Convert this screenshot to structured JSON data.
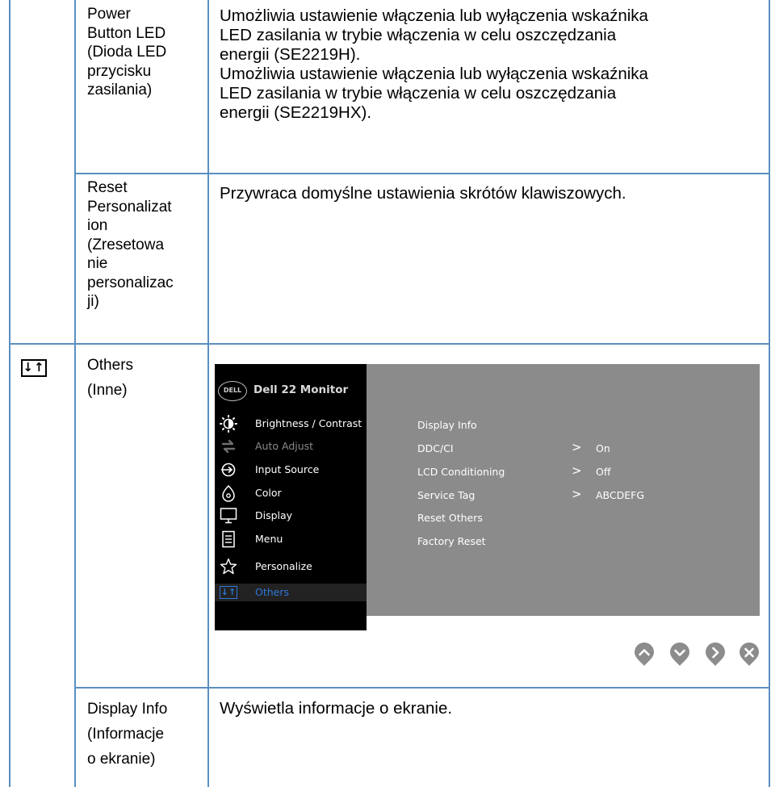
{
  "rows": [
    {
      "feature_lines": [
        "Power",
        "Button LED",
        "(Dioda LED",
        "przycisku",
        "zasilania)"
      ],
      "description_lines": [
        "Umożliwia ustawienie włączenia lub wyłączenia wskaźnika",
        "LED zasilania w trybie włączenia w celu oszczędzania",
        "energii (SE2219H).",
        "Umożliwia ustawienie włączenia lub wyłączenia wskaźnika",
        "LED zasilania w trybie włączenia w celu oszczędzania",
        "energii (SE2219HX)."
      ]
    },
    {
      "feature_lines": [
        "Reset",
        "Personalizat",
        "ion",
        "(Zresetowa",
        "nie",
        "personalizac",
        "ji)"
      ],
      "description_lines": [
        "Przywraca domyślne ustawienia skrótów klawiszowych."
      ]
    },
    {
      "icon": "others-icon",
      "icon_text": "↓↑",
      "feature_lines": [
        "Others",
        "(Inne)"
      ]
    },
    {
      "feature_lines": [
        "Display Info",
        "(Informacje",
        "o ekranie)"
      ],
      "description_lines": [
        "Wyświetla informacje o ekranie."
      ]
    }
  ],
  "osd": {
    "logo": "DELL",
    "title": "Dell 22 Monitor",
    "menu": [
      {
        "label": "Brightness / Contrast",
        "icon": "brightness-icon"
      },
      {
        "label": "Auto Adjust",
        "icon": "auto-adjust-icon"
      },
      {
        "label": "Input Source",
        "icon": "input-source-icon"
      },
      {
        "label": "Color",
        "icon": "color-icon"
      },
      {
        "label": "Display",
        "icon": "display-icon"
      },
      {
        "label": "Menu",
        "icon": "menu-icon"
      },
      {
        "label": "Personalize",
        "icon": "star-icon"
      },
      {
        "label": "Others",
        "icon": "others-icon",
        "icon_text": "↓↑"
      }
    ],
    "submenu": [
      {
        "label": "Display Info",
        "value": ""
      },
      {
        "label": "DDC/CI",
        "value": "On"
      },
      {
        "label": "LCD Conditioning",
        "value": "Off"
      },
      {
        "label": "Service Tag",
        "value": "ABCDEFG"
      },
      {
        "label": "Reset Others",
        "value": ""
      },
      {
        "label": "Factory Reset",
        "value": ""
      }
    ],
    "nav_buttons": [
      "up-button",
      "down-button",
      "right-button",
      "close-button"
    ],
    "colors": {
      "menu_bg": "#000000",
      "panel_bg": "#8b8b8b",
      "active": "#2f77d8",
      "button": "#8c8c8c",
      "border": "#5b8fc0"
    }
  }
}
